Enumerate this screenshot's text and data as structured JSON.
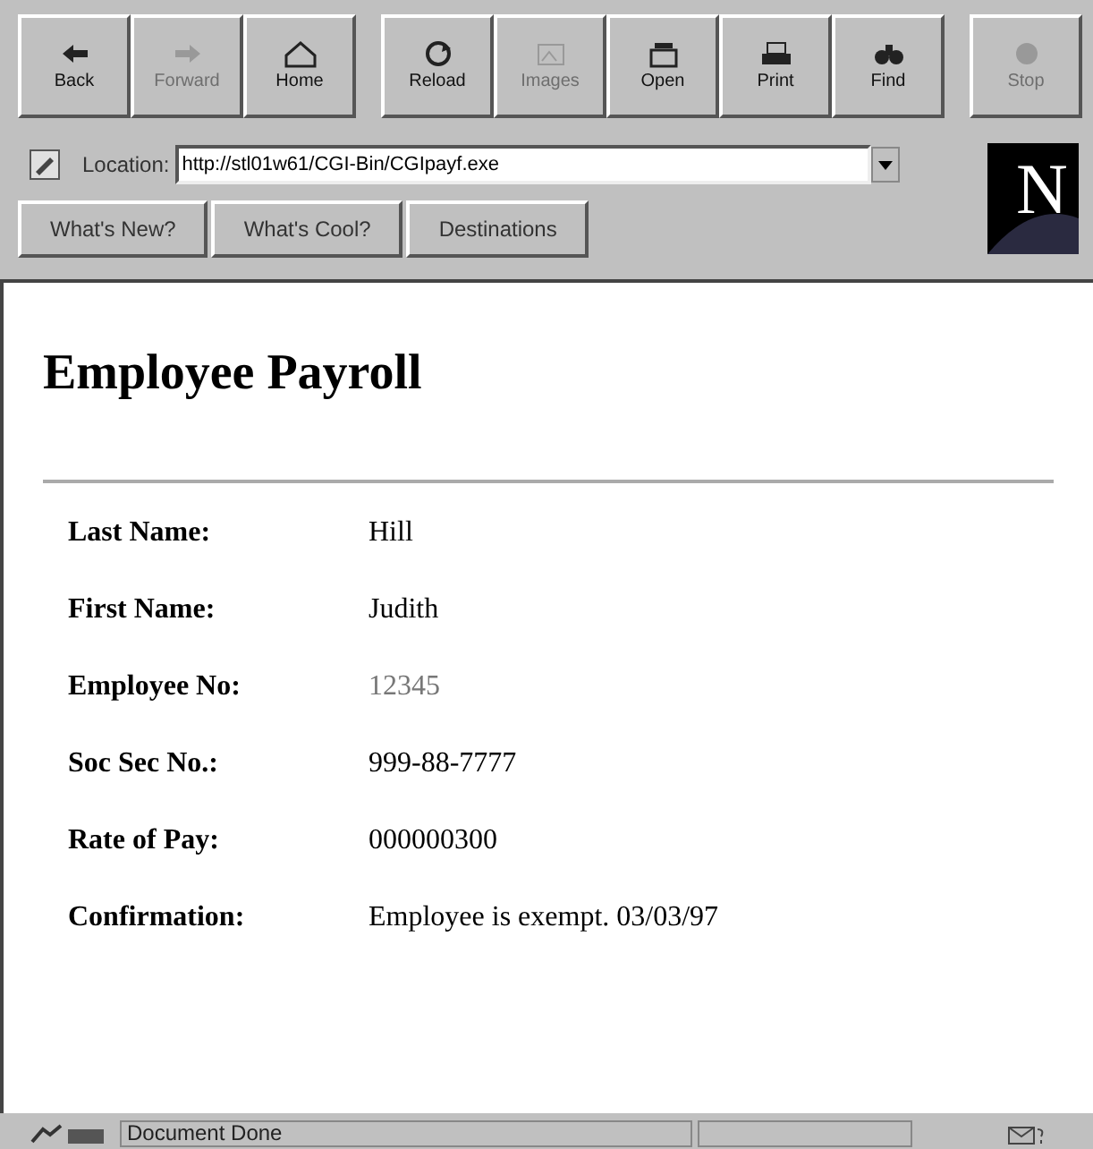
{
  "toolbar": {
    "groups": [
      {
        "buttons": [
          {
            "label": "Back",
            "disabled": false,
            "kind": "back"
          },
          {
            "label": "Forward",
            "disabled": true,
            "kind": "forward"
          },
          {
            "label": "Home",
            "disabled": false,
            "kind": "home"
          }
        ]
      },
      {
        "buttons": [
          {
            "label": "Reload",
            "disabled": false,
            "kind": "reload"
          },
          {
            "label": "Images",
            "disabled": true,
            "kind": "images"
          },
          {
            "label": "Open",
            "disabled": false,
            "kind": "open"
          },
          {
            "label": "Print",
            "disabled": false,
            "kind": "print"
          },
          {
            "label": "Find",
            "disabled": false,
            "kind": "find"
          }
        ]
      },
      {
        "buttons": [
          {
            "label": "Stop",
            "disabled": true,
            "kind": "stop"
          }
        ]
      }
    ]
  },
  "location": {
    "label": "Location:",
    "value": "http://stl01w61/CGI-Bin/CGIpayf.exe"
  },
  "directory_buttons": [
    "What's New?",
    "What's Cool?",
    "Destinations"
  ],
  "logo": {
    "letter": "N"
  },
  "page": {
    "heading": "Employee Payroll",
    "fields": [
      {
        "label": "Last Name:",
        "value": "Hill",
        "muted": false
      },
      {
        "label": "First Name:",
        "value": "Judith",
        "muted": false
      },
      {
        "label": "Employee No:",
        "value": "12345",
        "muted": true
      },
      {
        "label": "Soc Sec No.:",
        "value": "999-88-7777",
        "muted": false
      },
      {
        "label": "Rate of Pay:",
        "value": "000000300",
        "muted": false
      },
      {
        "label": "Confirmation:",
        "value": "Employee is exempt. 03/03/97",
        "muted": false
      }
    ]
  },
  "status_bar": {
    "text": "Document Done"
  }
}
